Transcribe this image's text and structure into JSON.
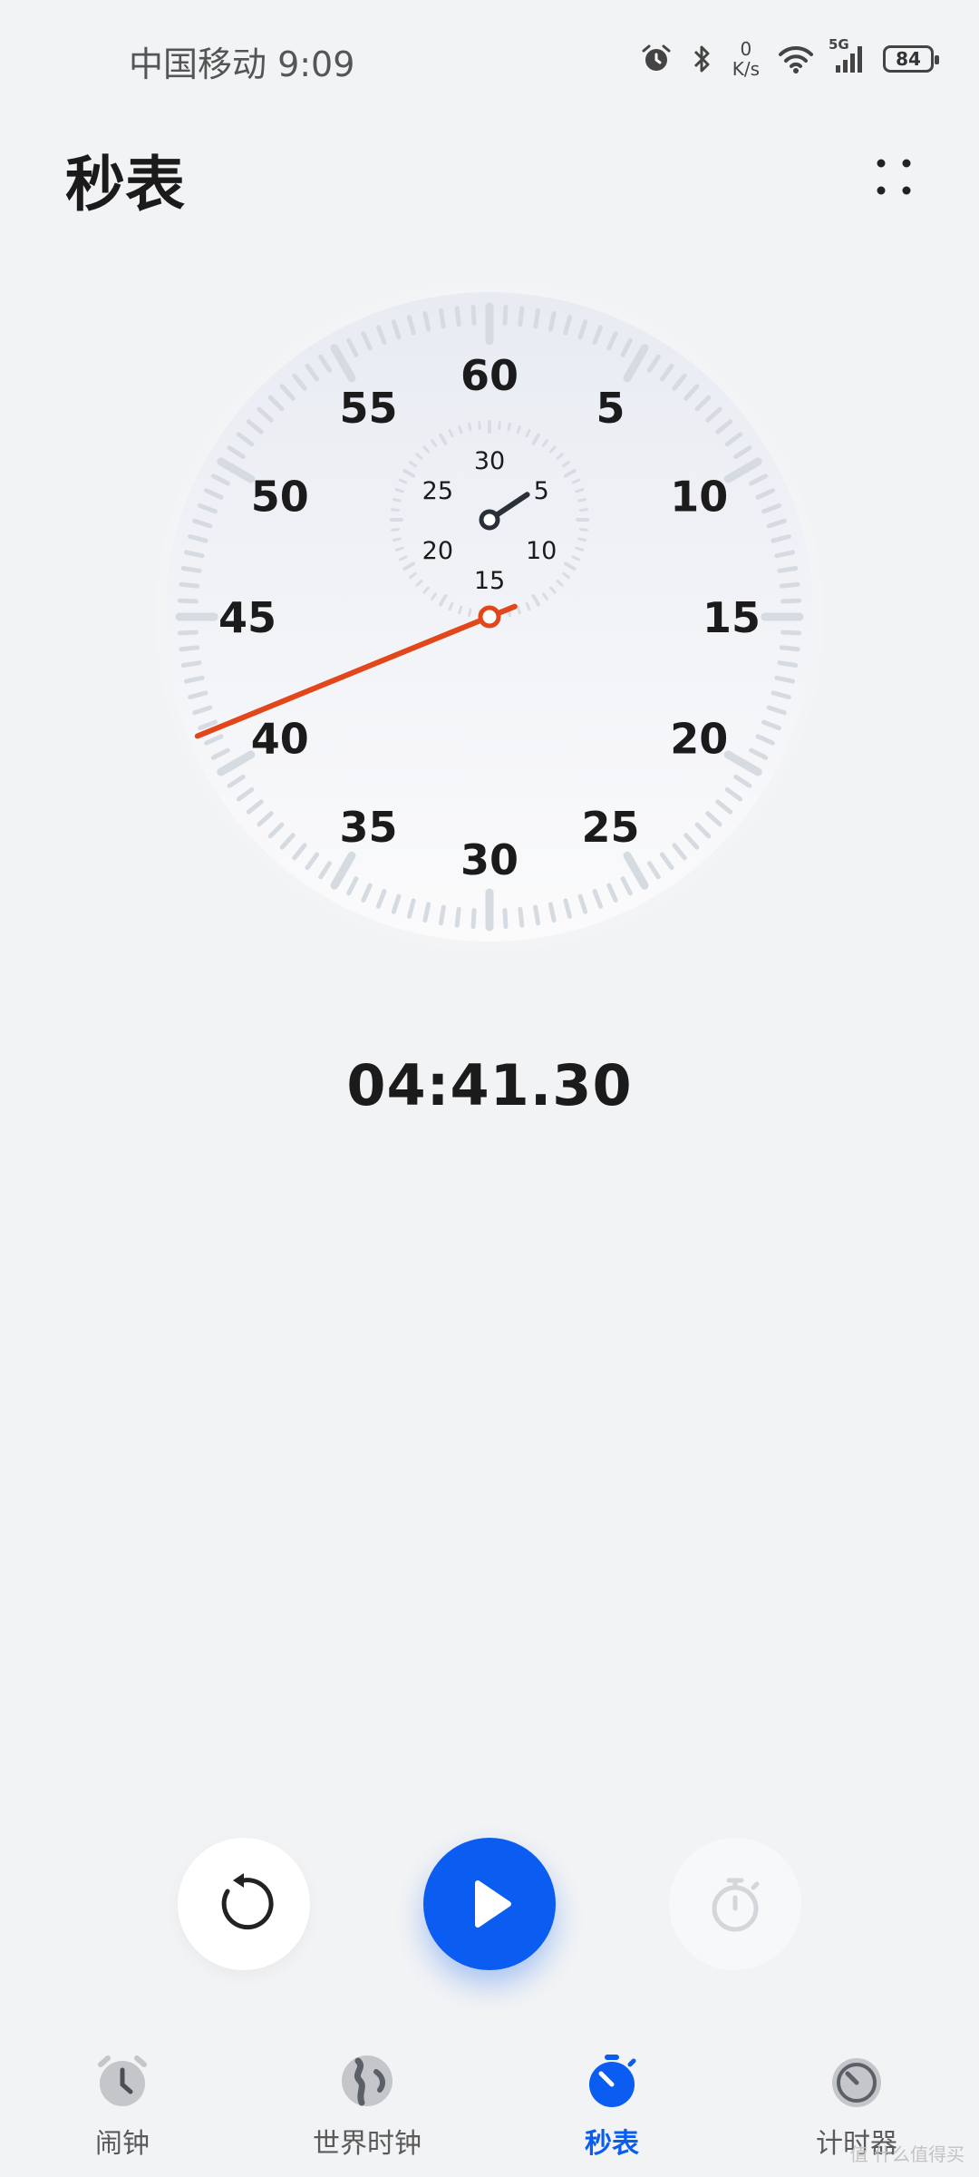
{
  "status_bar": {
    "carrier_time": "中国移动 9:09",
    "net_speed_value": "0",
    "net_speed_unit": "K/s",
    "network": "5G",
    "battery": "84",
    "icons": [
      "alarm-icon",
      "bluetooth-icon",
      "wifi-icon",
      "signal-icon",
      "battery-icon"
    ]
  },
  "header": {
    "title": "秒表",
    "more_icon": "grid-dots-icon"
  },
  "dial": {
    "main_labels": [
      "60",
      "5",
      "10",
      "15",
      "20",
      "25",
      "30",
      "35",
      "40",
      "45",
      "50",
      "55"
    ],
    "sub_labels": [
      "30",
      "5",
      "10",
      "15",
      "20",
      "25"
    ],
    "second_hand_value": 41.3,
    "minute_hand_value": 4.69,
    "colors": {
      "second_hand": "#e2461b",
      "minute_hand": "#2a3037",
      "ticks": "#d6dbe2"
    }
  },
  "elapsed": "04:41.30",
  "controls": {
    "reset_icon": "reset-icon",
    "start_icon": "play-icon",
    "lap_icon": "stopwatch-icon",
    "accent": "#0b5cf0"
  },
  "nav": {
    "items": [
      {
        "label": "闹钟",
        "icon": "alarm-clock-icon",
        "active": false
      },
      {
        "label": "世界时钟",
        "icon": "globe-icon",
        "active": false
      },
      {
        "label": "秒表",
        "icon": "stopwatch-icon",
        "active": true
      },
      {
        "label": "计时器",
        "icon": "timer-icon",
        "active": false
      }
    ]
  },
  "watermark": "值 什么值得买"
}
